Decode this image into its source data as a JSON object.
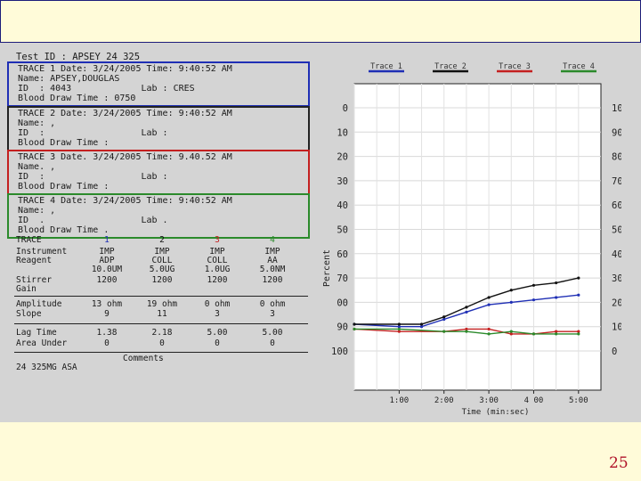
{
  "slide": {
    "page_number": "25"
  },
  "report": {
    "test_id": "Test ID : APSEY 24 325",
    "traces": [
      {
        "color": "#1f2fb5",
        "lines": [
          "TRACE 1 Date: 3/24/2005 Time: 9:40:52 AM",
          "Name: APSEY,DOUGLAS",
          "ID  : 4043             Lab : CRES",
          "Blood Draw Time : 0750"
        ]
      },
      {
        "color": "#222222",
        "lines": [
          "TRACE 2 Date: 3/24/2005 Time: 9:40:52 AM",
          "Name: ,",
          "ID  :                  Lab :",
          "Blood Draw Time :"
        ]
      },
      {
        "color": "#c42020",
        "lines": [
          "TRACE 3 Date. 3/24/2005 Time: 9.40.52 AM",
          "Name. ,",
          "ID  :                  Lab :",
          "Blood Draw Time :"
        ]
      },
      {
        "color": "#2b8a2b",
        "lines": [
          "TRACE 4 Date: 3/24/2005 Time: 9:40:52 AM",
          "Name: ,",
          "ID  .                  Lab .",
          "Blood Draw Time ."
        ]
      }
    ],
    "table": {
      "trace_label": "TRACE",
      "row_labels": [
        "Instrument",
        "Reagent",
        "",
        "Stirrer",
        "Gain",
        "Amplitude",
        "Slope",
        "Lag Time",
        "Area Under"
      ],
      "columns": [
        {
          "trace": "1",
          "color": "#1f2fb5",
          "instrument": "IMP",
          "reagent": "ADP",
          "reagent_conc": "10.0UM",
          "stirrer": "1200",
          "amplitude": "13 ohm",
          "slope": "9",
          "lag_time": "1.38",
          "area_under": "0"
        },
        {
          "trace": "2",
          "color": "#111111",
          "instrument": "IMP",
          "reagent": "COLL",
          "reagent_conc": "5.0UG",
          "stirrer": "1200",
          "amplitude": "19 ohm",
          "slope": "11",
          "lag_time": "2.18",
          "area_under": "0"
        },
        {
          "trace": "3",
          "color": "#c42020",
          "instrument": "IMP",
          "reagent": "COLL",
          "reagent_conc": "1.0UG",
          "stirrer": "1200",
          "amplitude": "0 ohm",
          "slope": "3",
          "lag_time": "5.00",
          "area_under": "0"
        },
        {
          "trace": "4",
          "color": "#2b8a2b",
          "instrument": "IMP",
          "reagent": "AA",
          "reagent_conc": "5.0NM",
          "stirrer": "1200",
          "amplitude": "0 ohm",
          "slope": "3",
          "lag_time": "5.00",
          "area_under": "0"
        }
      ],
      "comments_label": "Comments",
      "comment_text": "24 325MG ASA"
    }
  },
  "chart_data": {
    "type": "line",
    "xlabel": "Time (min:sec)",
    "ylabel": "Percent",
    "x_ticks": [
      "1:00",
      "2:00",
      "3:00",
      "4 00",
      "5:00"
    ],
    "x_range_min": [
      0,
      5.5
    ],
    "y_left_ticks": [
      "0",
      "10",
      "20",
      "30",
      "40",
      "50",
      "60",
      "70",
      "00",
      "90",
      "100"
    ],
    "y_right_ticks": [
      "100",
      "90",
      "80",
      "70",
      "60",
      "50",
      "40",
      "30",
      "20",
      "10",
      "0"
    ],
    "y_range": [
      0,
      100
    ],
    "y_inverted": true,
    "grid": true,
    "legend_position": "top",
    "legend": [
      "Trace 1",
      "Trace 2",
      "Trace 3",
      "Trace 4"
    ],
    "series": [
      {
        "name": "Trace 1",
        "color": "#1f2fb5",
        "x": [
          0,
          1.0,
          1.5,
          2.0,
          2.5,
          3.0,
          3.5,
          4.0,
          4.5,
          5.0
        ],
        "y": [
          89,
          90,
          90,
          87,
          84,
          81,
          80,
          79,
          78,
          77
        ]
      },
      {
        "name": "Trace 2",
        "color": "#111111",
        "x": [
          0,
          1.0,
          1.5,
          2.0,
          2.5,
          3.0,
          3.5,
          4.0,
          4.5,
          5.0
        ],
        "y": [
          89,
          89,
          89,
          86,
          82,
          78,
          75,
          73,
          72,
          70
        ]
      },
      {
        "name": "Trace 3",
        "color": "#c42020",
        "x": [
          0,
          1.0,
          2.0,
          2.5,
          3.0,
          3.5,
          4.0,
          4.5,
          5.0
        ],
        "y": [
          91,
          92,
          92,
          91,
          91,
          93,
          93,
          92,
          92
        ]
      },
      {
        "name": "Trace 4",
        "color": "#2b8a2b",
        "x": [
          0,
          1.0,
          2.0,
          2.5,
          3.0,
          3.5,
          4.0,
          4.5,
          5.0
        ],
        "y": [
          91,
          91,
          92,
          92,
          93,
          92,
          93,
          93,
          93
        ]
      }
    ]
  }
}
